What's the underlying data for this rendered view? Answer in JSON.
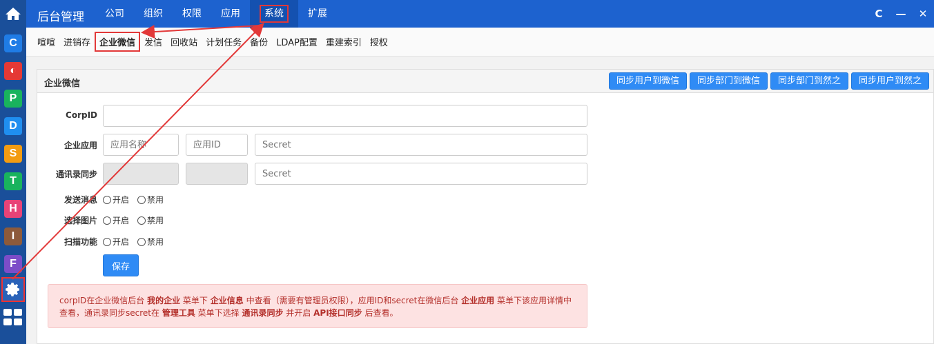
{
  "app": {
    "title": "后台管理"
  },
  "topnav": [
    {
      "label": "公司"
    },
    {
      "label": "组织"
    },
    {
      "label": "权限"
    },
    {
      "label": "应用"
    },
    {
      "label": "系统",
      "active": true
    },
    {
      "label": "扩展"
    }
  ],
  "window_controls": {
    "refresh": "C",
    "minimize": "—",
    "close": "✕"
  },
  "subnav": [
    {
      "label": "喧喧"
    },
    {
      "label": "进销存"
    },
    {
      "label": "企业微信",
      "active": true
    },
    {
      "label": "发信"
    },
    {
      "label": "回收站"
    },
    {
      "label": "计划任务"
    },
    {
      "label": "备份"
    },
    {
      "label": "LDAP配置"
    },
    {
      "label": "重建索引"
    },
    {
      "label": "授权"
    }
  ],
  "sidebar": {
    "apps": [
      {
        "letter": "C",
        "color": "#1f7ce6"
      },
      {
        "letter": "◐",
        "color": "#e53935"
      },
      {
        "letter": "P",
        "color": "#19b35d"
      },
      {
        "letter": "D",
        "color": "#1f8ef0"
      },
      {
        "letter": "S",
        "color": "#f39c12"
      },
      {
        "letter": "T",
        "color": "#19b35d"
      },
      {
        "letter": "H",
        "color": "#e84377"
      },
      {
        "letter": "I",
        "color": "#8d5a3b"
      },
      {
        "letter": "F",
        "color": "#7c4dc8"
      }
    ]
  },
  "panel": {
    "title": "企业微信",
    "buttons": [
      "同步用户到微信",
      "同步部门到微信",
      "同步部门到然之",
      "同步用户到然之"
    ]
  },
  "form": {
    "corpid_label": "CorpID",
    "corpid_value": "",
    "app_label": "企业应用",
    "app_name_placeholder": "应用名称",
    "app_id_placeholder": "应用ID",
    "secret_placeholder": "Secret",
    "contact_label": "通讯录同步",
    "contact_secret_placeholder": "Secret",
    "send_label": "发送消息",
    "image_label": "选择图片",
    "scan_label": "扫描功能",
    "on_label": "开启",
    "off_label": "禁用",
    "save_label": "保存"
  },
  "alert": {
    "t1": "corpID在企业微信后台 ",
    "b1": "我的企业",
    "t2": " 菜单下 ",
    "b2": "企业信息",
    "t3": " 中查看（需要有管理员权限），应用ID和secret在微信后台 ",
    "b3": "企业应用",
    "t4": " 菜单下该应用详情中查看，通讯录同步secret在 ",
    "b4": "管理工具",
    "t5": " 菜单下选择 ",
    "b5": "通讯录同步",
    "t6": " 并开启 ",
    "b6": "API接口同步",
    "t7": " 后查看。"
  },
  "colors": {
    "accent": "#2f8bf5",
    "topbar": "#1d62cf",
    "sidebar": "#1a4f9a",
    "annotation": "#e23838"
  }
}
